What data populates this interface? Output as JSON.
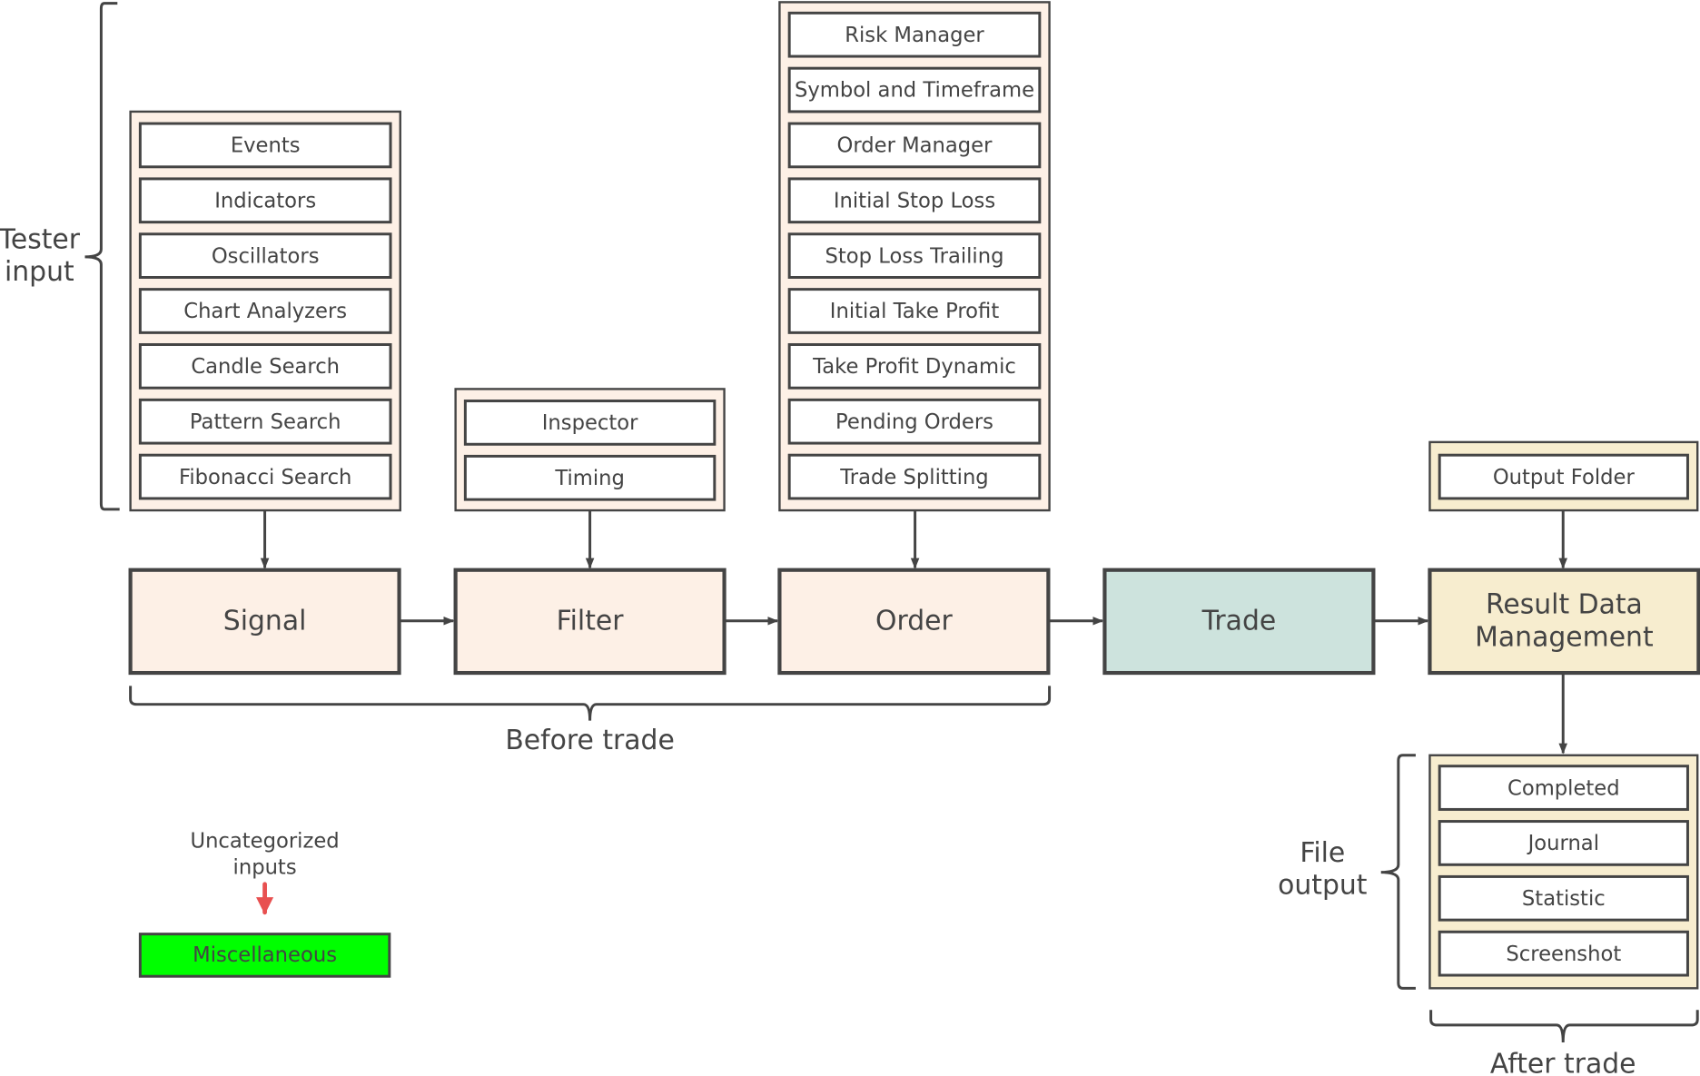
{
  "colors": {
    "peach": "#fdf0e6",
    "trade": "#cde3dd",
    "result": "#f7edcf",
    "misc": "#00ff00",
    "red_arrow": "#e85050",
    "stroke": "#444444"
  },
  "labels": {
    "tester_input": [
      "Tester",
      "input"
    ],
    "before_trade": "Before trade",
    "after_trade": "After trade",
    "file_output": [
      "File",
      "output"
    ],
    "uncategorized": [
      "Uncategorized",
      "inputs"
    ]
  },
  "signal_inputs": [
    "Events",
    "Indicators",
    "Oscillators",
    "Chart Analyzers",
    "Candle Search",
    "Pattern Search",
    "Fibonacci Search"
  ],
  "filter_inputs": [
    "Inspector",
    "Timing"
  ],
  "order_inputs": [
    "Risk Manager",
    "Symbol and Timeframe",
    "Order Manager",
    "Initial Stop Loss",
    "Stop Loss Trailing",
    "Initial Take Profit",
    "Take Profit Dynamic",
    "Pending Orders",
    "Trade Splitting"
  ],
  "result_inputs": [
    "Output Folder"
  ],
  "stages": [
    "Signal",
    "Filter",
    "Order",
    "Trade",
    [
      "Result Data",
      "Management"
    ]
  ],
  "file_outputs": [
    "Completed",
    "Journal",
    "Statistic",
    "Screenshot"
  ],
  "misc": "Miscellaneous"
}
